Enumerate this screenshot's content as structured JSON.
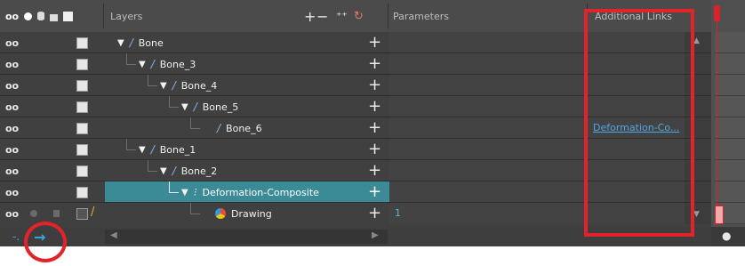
{
  "header": {
    "layers_label": "Layers",
    "parameters_label": "Parameters",
    "links_label": "Additional Links"
  },
  "rows": [
    {
      "name": "Bone",
      "icon": "bone-icon",
      "depth": 0,
      "selected": false,
      "param": "",
      "link": ""
    },
    {
      "name": "Bone_3",
      "icon": "bone-icon",
      "depth": 1,
      "selected": false,
      "param": "",
      "link": ""
    },
    {
      "name": "Bone_4",
      "icon": "bone-icon",
      "depth": 2,
      "selected": false,
      "param": "",
      "link": ""
    },
    {
      "name": "Bone_5",
      "icon": "bone-icon",
      "depth": 3,
      "selected": false,
      "param": "",
      "link": ""
    },
    {
      "name": "Bone_6",
      "icon": "bone-icon",
      "depth": 4,
      "selected": false,
      "param": "",
      "link": "Deformation-Co..."
    },
    {
      "name": "Bone_1",
      "icon": "bone-icon",
      "depth": 1,
      "selected": false,
      "param": "",
      "link": ""
    },
    {
      "name": "Bone_2",
      "icon": "bone-icon",
      "depth": 2,
      "selected": false,
      "param": "",
      "link": ""
    },
    {
      "name": "Deformation-Composite",
      "icon": "deformation-composite-icon",
      "depth": 3,
      "selected": true,
      "param": "",
      "link": ""
    },
    {
      "name": "Drawing",
      "icon": "drawing-icon",
      "depth": 4,
      "selected": false,
      "param": "1",
      "link": ""
    }
  ],
  "colors": {
    "selection": "#3a8b96",
    "annotation": "#e3232a",
    "link": "#4aa9e6"
  }
}
